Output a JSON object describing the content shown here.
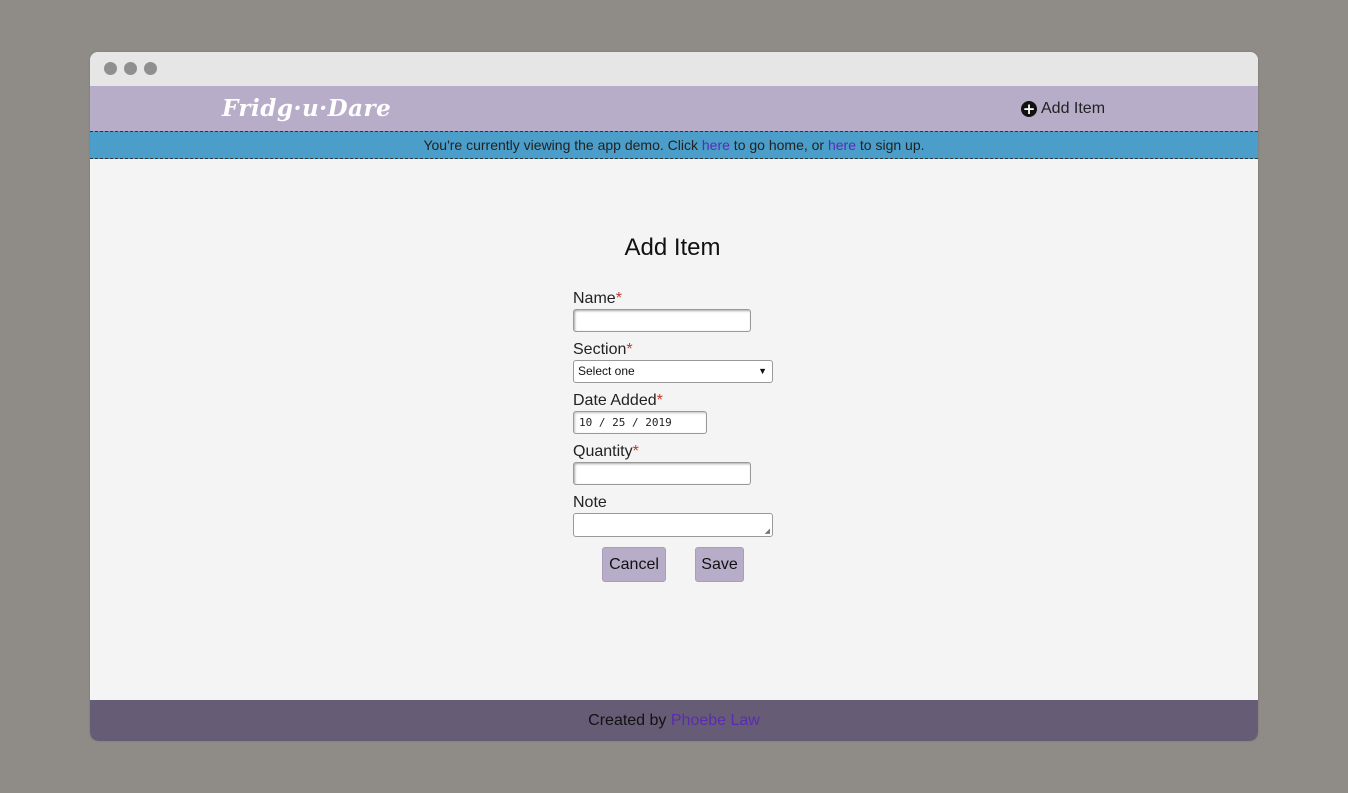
{
  "app": {
    "logo_text": "Fridg·u·Dare"
  },
  "nav": {
    "add_item_label": "Add Item",
    "add_icon": "plus-circle-icon"
  },
  "banner": {
    "text_before": "You're currently viewing the app demo. Click ",
    "link_home": "here",
    "text_middle": " to go home, or ",
    "link_signup": "here",
    "text_after": " to sign up."
  },
  "page": {
    "title": "Add Item"
  },
  "form": {
    "name_label": "Name",
    "name_value": "",
    "section_label": "Section",
    "section_selected": "Select one",
    "date_label": "Date Added",
    "date_value": "10 / 25 / 2019",
    "quantity_label": "Quantity",
    "quantity_value": "",
    "note_label": "Note",
    "note_value": "",
    "required_marker": "*"
  },
  "actions": {
    "cancel_label": "Cancel",
    "save_label": "Save"
  },
  "footer": {
    "text": "Created by ",
    "author_link": "Phoebe Law"
  },
  "colors": {
    "navbar": "#b8adc9",
    "banner": "#4a9ec9",
    "footer": "#675c75",
    "link": "#5b2bb0",
    "required": "#c0392b"
  }
}
